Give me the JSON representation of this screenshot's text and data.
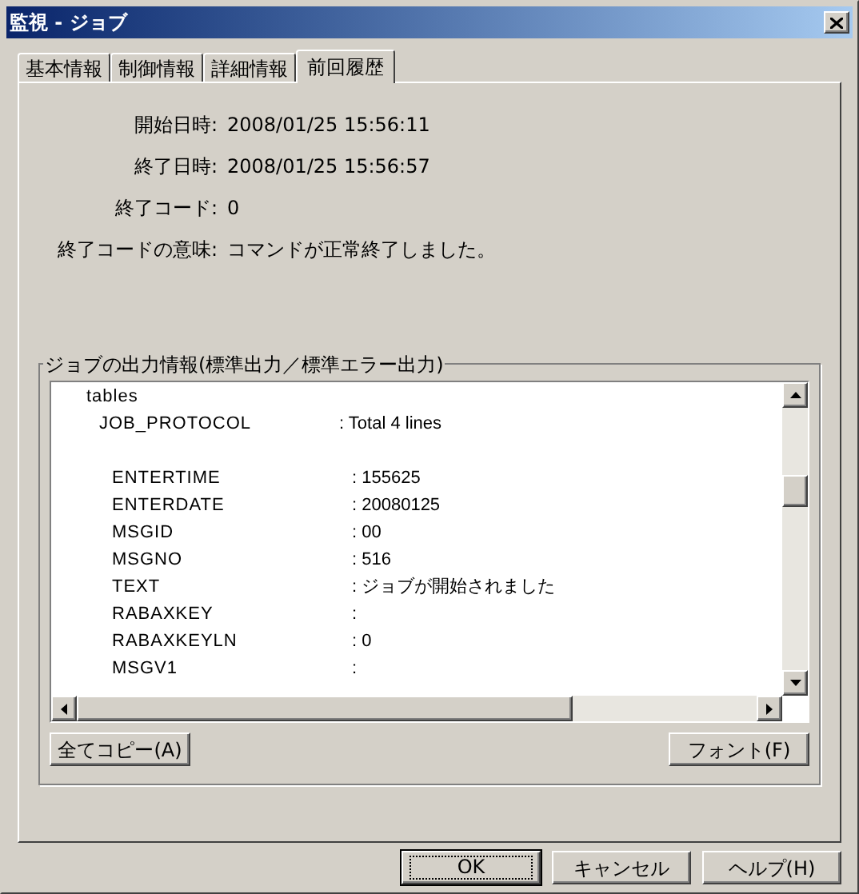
{
  "window": {
    "title": "監視 - ジョブ"
  },
  "tabs": [
    {
      "label": "基本情報",
      "selected": false
    },
    {
      "label": "制御情報",
      "selected": false
    },
    {
      "label": "詳細情報",
      "selected": false
    },
    {
      "label": "前回履歴",
      "selected": true
    }
  ],
  "fields": [
    {
      "label": "開始日時:",
      "value": "2008/01/25 15:56:11"
    },
    {
      "label": "終了日時:",
      "value": "2008/01/25 15:56:57"
    },
    {
      "label": "終了コード:",
      "value": "0"
    },
    {
      "label": "終了コードの意味:",
      "value": "コマンドが正常終了しました。"
    }
  ],
  "output_group": {
    "title": "ジョブの出力情報(標準出力／標準エラー出力)",
    "lines": [
      {
        "key": "tables",
        "children": [
          {
            "key": "JOB_PROTOCOL",
            "value": ": Total 4 lines",
            "children": [
              {
                "key": "ENTERTIME",
                "value": ": 155625"
              },
              {
                "key": "ENTERDATE",
                "value": ": 20080125"
              },
              {
                "key": "MSGID",
                "value": ": 00"
              },
              {
                "key": "MSGNO",
                "value": ": 516"
              },
              {
                "key": "TEXT",
                "value": ": ジョブが開始されました"
              },
              {
                "key": "RABAXKEY",
                "value": ":"
              },
              {
                "key": "RABAXKEYLN",
                "value": ": 0"
              },
              {
                "key": "MSGV1",
                "value": ":"
              }
            ]
          }
        ]
      }
    ],
    "buttons": [
      "全てコピー(A)",
      "フォント(F)"
    ]
  },
  "footer_buttons": [
    {
      "label": "OK",
      "default": true
    },
    {
      "label": "キャンセル",
      "default": false
    },
    {
      "label": "ヘルプ(H)",
      "default": false
    }
  ]
}
